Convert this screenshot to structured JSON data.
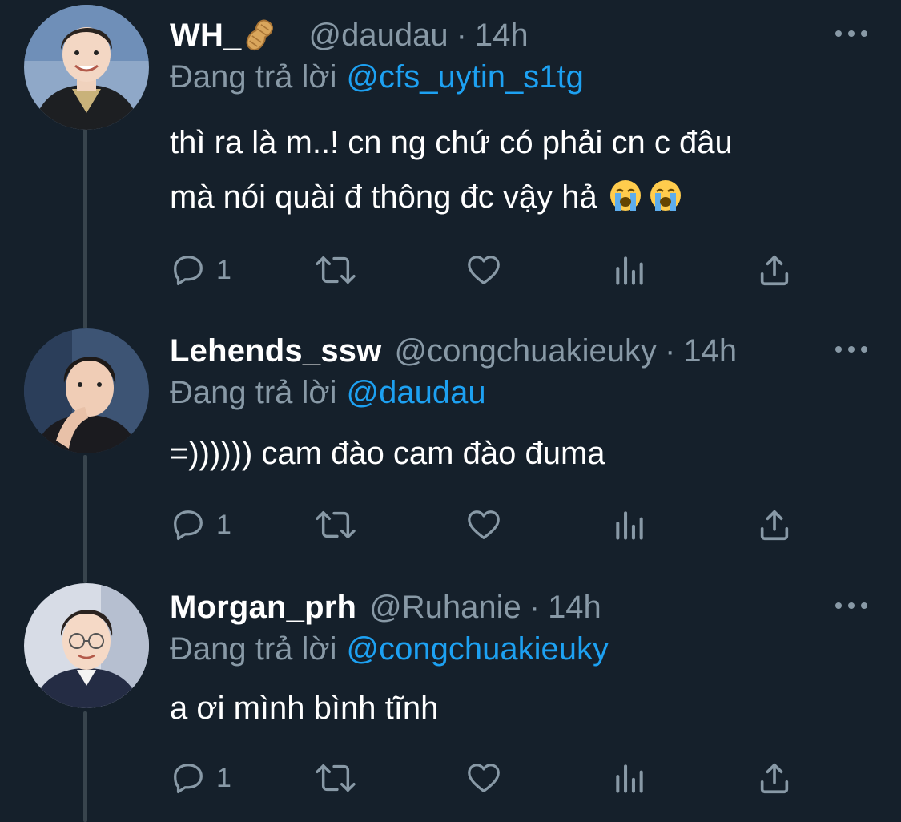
{
  "colors": {
    "background": "#15202b",
    "secondary_text": "#8899a6",
    "link": "#1da1f2",
    "thread_line": "#38444d"
  },
  "replying_prefix": "Đang trả lời",
  "tweets": [
    {
      "display_name": "WH_",
      "name_emoji": "peanut-emoji",
      "handle": "@daudau",
      "dot": "·",
      "time": "14h",
      "reply_to": "@cfs_uytin_s1tg",
      "text_lines": [
        "thì ra là m..! cn ng chứ có phải cn c đâu",
        "mà nói quài đ thông đc vậy hả"
      ],
      "trailing_emojis": [
        "loudly-crying-face-emoji",
        "loudly-crying-face-emoji"
      ],
      "reply_count": "1"
    },
    {
      "display_name": "Lehends_ssw",
      "handle": "@congchuakieuky",
      "dot": "·",
      "time": "14h",
      "reply_to": "@daudau",
      "text_lines": [
        "=)))))) cam đào cam đào đuma"
      ],
      "reply_count": "1"
    },
    {
      "display_name": "Morgan_prh",
      "handle": "@Ruhanie",
      "dot": "·",
      "time": "14h",
      "reply_to": "@congchuakieuky",
      "text_lines": [
        "a ơi mình bình tĩnh"
      ],
      "reply_count": "1"
    }
  ]
}
